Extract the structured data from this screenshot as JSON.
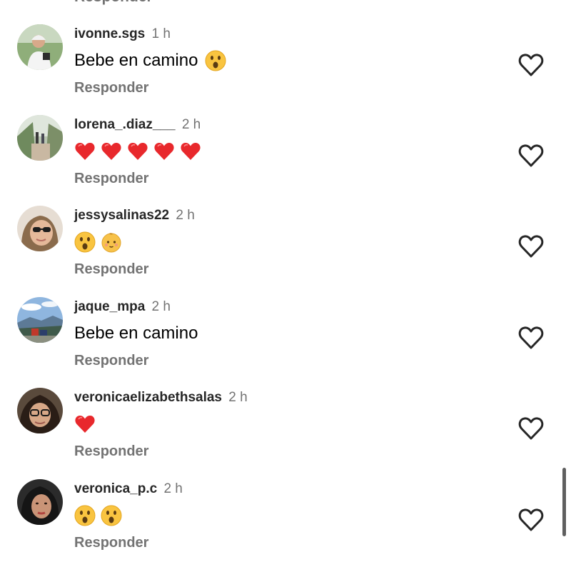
{
  "top_partial_reply": "Responder",
  "comments": [
    {
      "username": "ivonne.sgs",
      "time": "1 h",
      "text": "Bebe en camino",
      "emojis": [
        "astonished-face"
      ],
      "reply_label": "Responder"
    },
    {
      "username": "lorena_.diaz___",
      "time": "2 h",
      "text": "",
      "emojis": [
        "red-heart",
        "red-heart",
        "red-heart",
        "red-heart",
        "red-heart"
      ],
      "reply_label": "Responder"
    },
    {
      "username": "jessysalinas22",
      "time": "2 h",
      "text": "",
      "emojis": [
        "astonished-face",
        "baby-face"
      ],
      "reply_label": "Responder"
    },
    {
      "username": "jaque_mpa",
      "time": "2 h",
      "text": "Bebe en camino",
      "emojis": [],
      "reply_label": "Responder"
    },
    {
      "username": "veronicaelizabethsalas",
      "time": "2 h",
      "text": "",
      "emojis": [
        "red-heart"
      ],
      "reply_label": "Responder"
    },
    {
      "username": "veronica_p.c",
      "time": "2 h",
      "text": "",
      "emojis": [
        "astonished-face",
        "astonished-face"
      ],
      "reply_label": "Responder"
    }
  ],
  "colors": {
    "username": "#262626",
    "secondary_text": "#737373",
    "heart_outline": "#262626",
    "scrollbar": "#5f5f5f"
  }
}
